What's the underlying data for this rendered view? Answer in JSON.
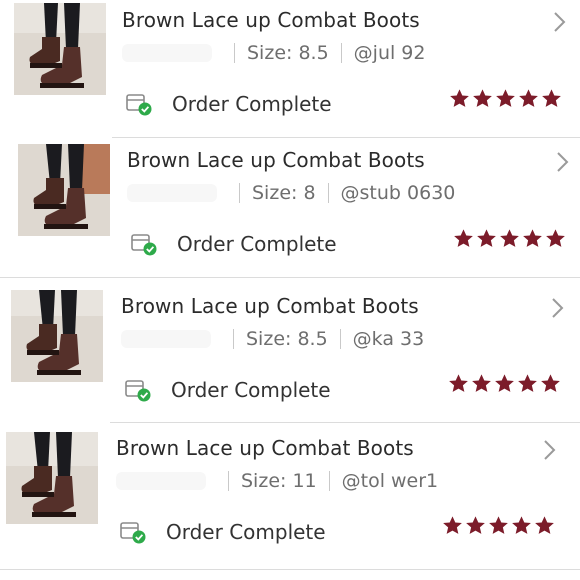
{
  "orders": [
    {
      "title": "Brown Lace up Combat Boots",
      "size_label": "Size: 8.5",
      "user": "@jul        92",
      "status": "Order Complete",
      "rating": 5
    },
    {
      "title": "Brown Lace up Combat Boots",
      "size_label": "Size: 8",
      "user": "@stub       0630",
      "status": "Order Complete",
      "rating": 5
    },
    {
      "title": "Brown Lace up Combat Boots",
      "size_label": "Size: 8.5",
      "user": "@ka        33",
      "status": "Order Complete",
      "rating": 5
    },
    {
      "title": "Brown Lace up Combat Boots",
      "size_label": "Size: 11",
      "user": "@tol        wer1",
      "status": "Order Complete",
      "rating": 5
    }
  ],
  "colors": {
    "star": "#7c1c2a",
    "check": "#2eaa4a",
    "boot": "#4a2a22"
  },
  "icons": {
    "status": "box-check-icon",
    "chevron": "chevron-right-icon",
    "star": "star-icon"
  }
}
